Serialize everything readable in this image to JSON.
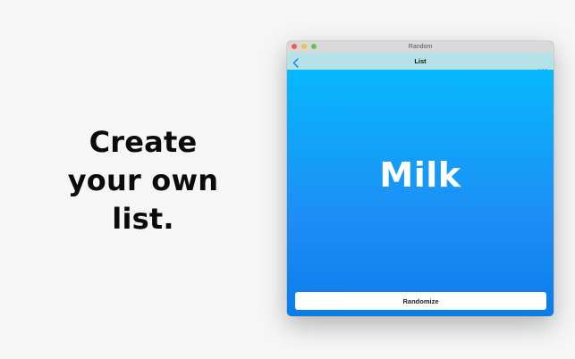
{
  "promo": {
    "headline_lines": [
      "Create",
      "your own",
      "list."
    ]
  },
  "window": {
    "title": "Random",
    "navbar": {
      "title": "List",
      "back_icon": "chevron-left-icon",
      "more_icon": "ellipsis-icon"
    },
    "content": {
      "item_text": "Milk",
      "button_label": "Randomize"
    }
  },
  "colors": {
    "accent": "#1e8cf5",
    "navbar": "#b4e2e8",
    "page_background": "#f6f6f6"
  }
}
